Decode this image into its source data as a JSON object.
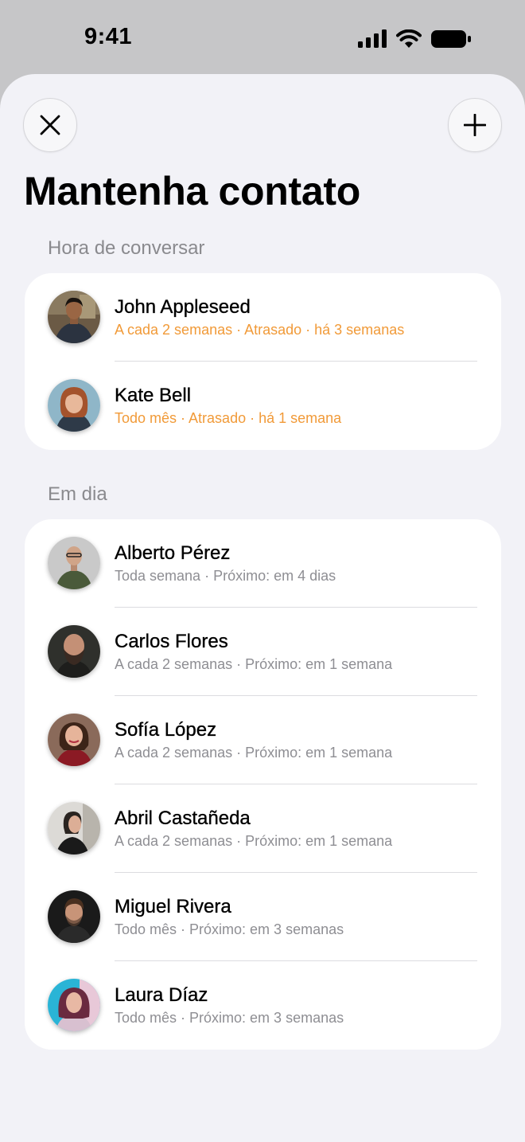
{
  "status_bar": {
    "time": "9:41"
  },
  "header": {
    "title": "Mantenha contato"
  },
  "sections": [
    {
      "title": "Hora de conversar",
      "contacts": [
        {
          "name": "John Appleseed",
          "detail": "A cada 2 semanas · Atrasado · há 3 semanas",
          "overdue": true
        },
        {
          "name": "Kate Bell",
          "detail": "Todo mês · Atrasado · há 1 semana",
          "overdue": true
        }
      ]
    },
    {
      "title": "Em dia",
      "contacts": [
        {
          "name": "Alberto Pérez",
          "detail": "Toda semana · Próximo: em 4 dias",
          "overdue": false
        },
        {
          "name": "Carlos Flores",
          "detail": "A cada 2 semanas · Próximo: em 1 semana",
          "overdue": false
        },
        {
          "name": "Sofía López",
          "detail": "A cada 2 semanas · Próximo: em 1 semana",
          "overdue": false
        },
        {
          "name": "Abril Castañeda",
          "detail": "A cada 2 semanas · Próximo: em 1 semana",
          "overdue": false
        },
        {
          "name": "Miguel Rivera",
          "detail": "Todo mês · Próximo: em 3 semanas",
          "overdue": false
        },
        {
          "name": "Laura Díaz",
          "detail": "Todo mês · Próximo: em 3 semanas",
          "overdue": false
        }
      ]
    }
  ],
  "colors": {
    "overdue": "#f19a38",
    "secondary": "#8e8e93",
    "sheet_bg": "#f2f2f7"
  },
  "icons": {
    "close": "close-icon",
    "add": "plus-icon",
    "signal": "cellular-signal-icon",
    "wifi": "wifi-icon",
    "battery": "battery-icon"
  }
}
